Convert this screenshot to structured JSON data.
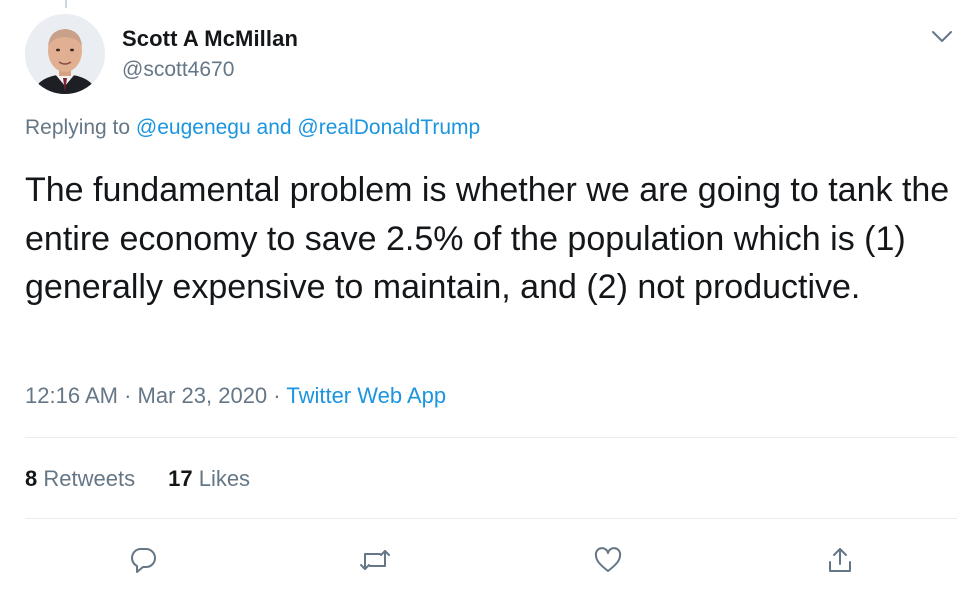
{
  "author": {
    "name": "Scott A McMillan",
    "handle": "@scott4670"
  },
  "replying": {
    "prefix": "Replying to",
    "user1": "@eugenegu",
    "conjunction": "and",
    "user2": "@realDonaldTrump"
  },
  "tweet": {
    "text": "The fundamental problem is whether we are going to tank the entire economy to save 2.5% of the population which is (1) generally expensive to maintain, and (2) not productive."
  },
  "meta": {
    "time": "12:16 AM",
    "separator1": "·",
    "date": "Mar 23, 2020",
    "separator2": "·",
    "source": "Twitter Web App"
  },
  "stats": {
    "retweets_count": "8",
    "retweets_label": "Retweets",
    "likes_count": "17",
    "likes_label": "Likes"
  },
  "icons": {
    "menu": "chevron-down-icon",
    "reply": "reply-icon",
    "retweet": "retweet-icon",
    "like": "heart-icon",
    "share": "share-icon"
  },
  "colors": {
    "link": "#1b95e0",
    "secondary_text": "#657786",
    "primary_text": "#14171a",
    "divider": "#e6ecf0"
  }
}
